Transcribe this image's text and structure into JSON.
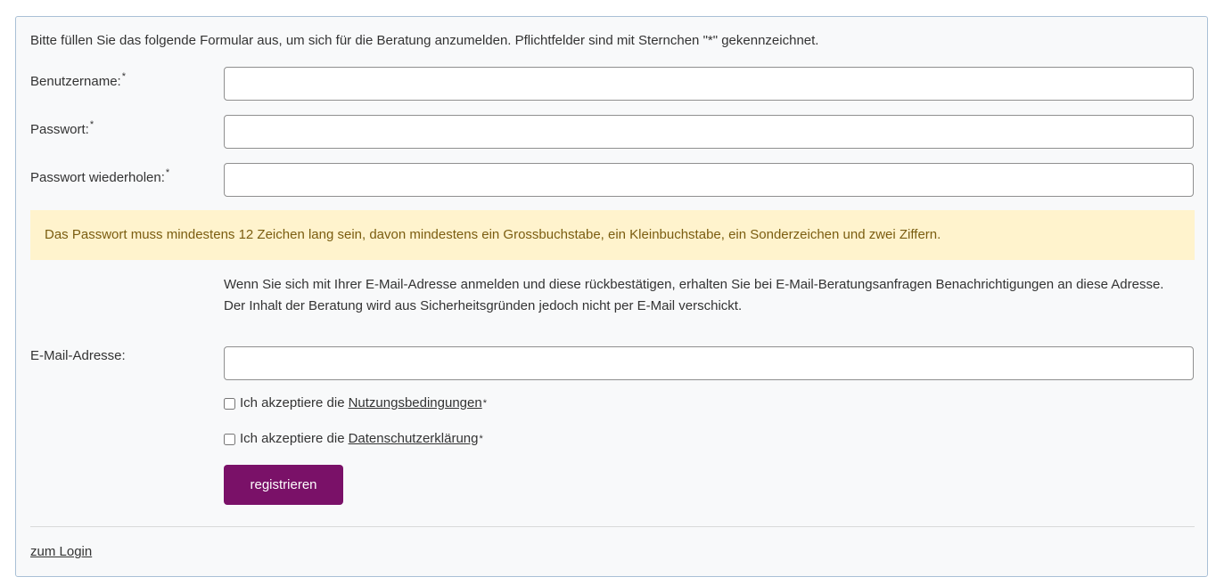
{
  "form": {
    "intro": "Bitte füllen Sie das folgende Formular aus, um sich für die Beratung anzumelden. Pflichtfelder sind mit Sternchen \"*\" gekennzeichnet.",
    "required_marker": "*",
    "username": {
      "label": "Benutzername:",
      "value": "",
      "placeholder": ""
    },
    "password": {
      "label": "Passwort:",
      "value": "",
      "placeholder": ""
    },
    "password_repeat": {
      "label": "Passwort wiederholen:",
      "value": "",
      "placeholder": ""
    },
    "password_hint": "Das Passwort muss mindestens 12 Zeichen lang sein, davon mindestens ein Grossbuchstabe, ein Kleinbuchstabe, ein Sonderzeichen und zwei Ziffern.",
    "email_info": "Wenn Sie sich mit Ihrer E-Mail-Adresse anmelden und diese rückbestätigen, erhalten Sie bei E-Mail-Beratungsanfragen Benachrichtigungen an diese Adresse. Der Inhalt der Beratung wird aus Sicherheitsgründen jedoch nicht per E-Mail verschickt.",
    "email": {
      "label": "E-Mail-Adresse:",
      "value": "",
      "placeholder": ""
    },
    "terms": {
      "prefix": "Ich akzeptiere die",
      "link": "Nutzungsbedingungen",
      "checked": false
    },
    "privacy": {
      "prefix": "Ich akzeptiere die",
      "link": "Datenschutzerklärung",
      "checked": false
    },
    "submit_label": "registrieren",
    "login_link": "zum Login"
  },
  "colors": {
    "button_bg": "#7a1168",
    "alert_bg": "#fff3cd",
    "alert_text": "#7a5d10",
    "panel_border": "#a9c0d6"
  }
}
